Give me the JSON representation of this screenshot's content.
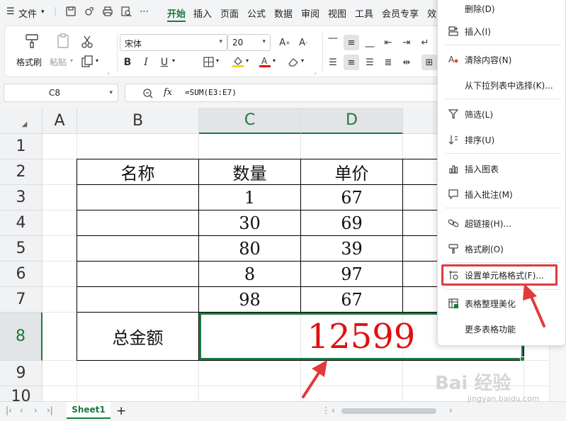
{
  "menu": {
    "file_label": "文件",
    "tabs": [
      "开始",
      "插入",
      "页面",
      "公式",
      "数据",
      "审阅",
      "视图",
      "工具",
      "会员专享",
      "效"
    ]
  },
  "ribbon": {
    "format_painter": "格式刷",
    "paste": "粘贴",
    "font_name": "宋体",
    "font_size": "20"
  },
  "formula_bar": {
    "cell_ref": "C8",
    "fx": "fx",
    "formula": "=SUM(E3:E7)"
  },
  "grid": {
    "columns": [
      "A",
      "B",
      "C",
      "D"
    ],
    "rows": [
      "1",
      "2",
      "3",
      "4",
      "5",
      "6",
      "7",
      "8",
      "9",
      "10"
    ],
    "header": {
      "name": "名称",
      "quantity": "数量",
      "price": "单价"
    },
    "data_rows": [
      {
        "qty": "1",
        "price": "67"
      },
      {
        "qty": "30",
        "price": "69"
      },
      {
        "qty": "80",
        "price": "39"
      },
      {
        "qty": "8",
        "price": "97"
      },
      {
        "qty": "98",
        "price": "67"
      }
    ],
    "total_label": "总金额",
    "total_value": "12599",
    "total_color": "#e01010"
  },
  "context_menu": {
    "items": [
      "删除(D)",
      "插入(I)",
      "清除内容(N)",
      "从下拉列表中选择(K)...",
      "筛选(L)",
      "排序(U)",
      "插入图表",
      "插入批注(M)",
      "超链接(H)...",
      "格式刷(O)",
      "设置单元格格式(F)...",
      "表格整理美化",
      "更多表格功能"
    ],
    "highlight_color": "#e03b3b"
  },
  "sheet_tabs": {
    "active": "Sheet1",
    "add": "+"
  },
  "watermark": {
    "main": "Bai 经验",
    "sub": "jingyan.baidu.com"
  },
  "accent_color": "#1a7a3f"
}
